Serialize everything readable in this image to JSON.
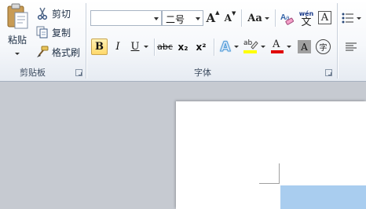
{
  "clipboard": {
    "paste_label": "粘贴",
    "cut_label": "剪切",
    "copy_label": "复制",
    "format_painter_label": "格式刷",
    "group_label": "剪贴板"
  },
  "font": {
    "font_name_value": "",
    "font_size_value": "二号",
    "grow_font_label": "A",
    "shrink_font_label": "A",
    "change_case_label": "Aa",
    "phonetic_top": "wén",
    "phonetic_bottom": "文",
    "border_char": "A",
    "bold_label": "B",
    "italic_label": "I",
    "underline_label": "U",
    "strike_label": "abc",
    "subscript_label": "x₂",
    "superscript_label": "x²",
    "text_effect_label": "A",
    "highlight_label": "ab",
    "font_color_label": "A",
    "shading_label": "A",
    "enclose_label": "字",
    "group_label": "字体"
  },
  "colors": {
    "highlight": "#ffff00",
    "font_color": "#e00000",
    "effect_blue": "#4f9bd9"
  }
}
